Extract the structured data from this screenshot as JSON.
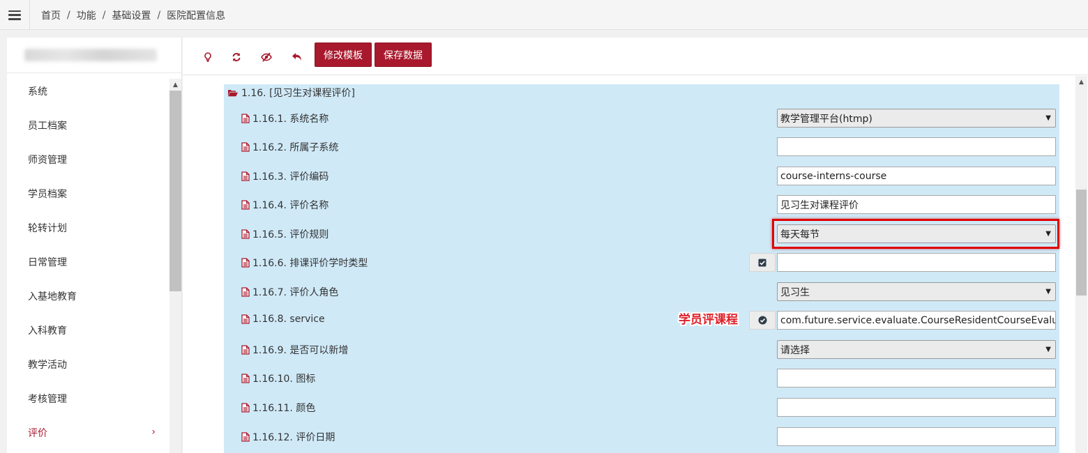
{
  "breadcrumb": {
    "home": "首页",
    "function": "功能",
    "settings": "基础设置",
    "current": "医院配置信息",
    "separator": "/"
  },
  "sidebar": {
    "items": [
      {
        "label": "系统"
      },
      {
        "label": "员工档案"
      },
      {
        "label": "师资管理"
      },
      {
        "label": "学员档案"
      },
      {
        "label": "轮转计划"
      },
      {
        "label": "日常管理"
      },
      {
        "label": "入基地教育"
      },
      {
        "label": "入科教育"
      },
      {
        "label": "教学活动"
      },
      {
        "label": "考核管理"
      },
      {
        "label": "评价",
        "active": true
      }
    ],
    "chevron": "›"
  },
  "toolbar": {
    "icons": [
      "lightbulb-icon",
      "refresh-icon",
      "eye-slash-icon",
      "undo-icon"
    ],
    "edit_template_label": "修改模板",
    "save_data_label": "保存数据"
  },
  "group": {
    "title": "1.16. [见习生对课程评价]"
  },
  "rows": [
    {
      "label": "1.16.1. 系统名称",
      "type": "select",
      "value": "教学管理平台(htmp)"
    },
    {
      "label": "1.16.2. 所属子系统",
      "type": "input",
      "value": ""
    },
    {
      "label": "1.16.3. 评价编码",
      "type": "input",
      "value": "course-interns-course"
    },
    {
      "label": "1.16.4. 评价名称",
      "type": "input",
      "value": "见习生对课程评价"
    },
    {
      "label": "1.16.5. 评价规则",
      "type": "select",
      "value": "每天每节"
    },
    {
      "label": "1.16.6. 排课评价学时类型",
      "type": "input",
      "value": ""
    },
    {
      "label": "1.16.7. 评价人角色",
      "type": "select",
      "value": "见习生"
    },
    {
      "label": "1.16.8. service",
      "type": "input",
      "value": "com.future.service.evaluate.CourseResidentCourseEvaluate"
    },
    {
      "label": "1.16.9. 是否可以新增",
      "type": "select",
      "value": "请选择"
    },
    {
      "label": "1.16.10. 图标",
      "type": "input",
      "value": ""
    },
    {
      "label": "1.16.11. 颜色",
      "type": "input",
      "value": ""
    },
    {
      "label": "1.16.12. 评价日期",
      "type": "input",
      "value": ""
    }
  ],
  "annotation": {
    "text": "学员评课程"
  },
  "colors": {
    "accent": "#a8192d",
    "group_bg": "#cfe9f7",
    "highlight": "#e00000"
  }
}
